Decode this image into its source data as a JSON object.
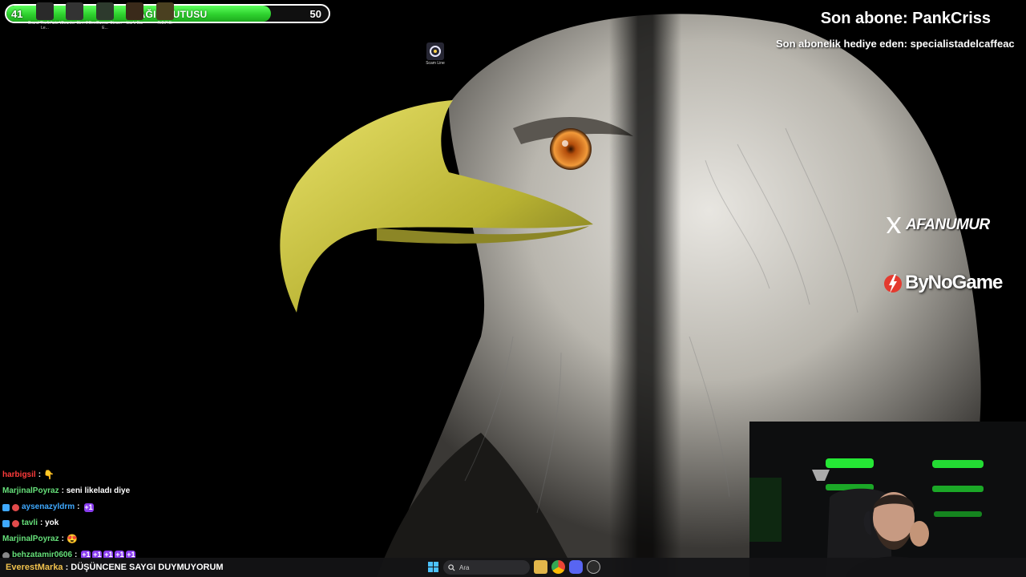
{
  "donation": {
    "title": "BAĞIŞ KUTUSU",
    "current": "41",
    "goal": "50",
    "progress_fraction": 0.82,
    "fill_color": "#33d633"
  },
  "desktop_icons": [
    {
      "label": "Grand Theft Auto V Le...",
      "icon": "gta-icon"
    },
    {
      "label": "Counter-Str... 2",
      "icon": "cs2-icon"
    },
    {
      "label": "GeoGuessr Steam E...",
      "icon": "geoguessr-icon"
    },
    {
      "label": "Liar's Bar",
      "icon": "liars-bar-icon"
    },
    {
      "label": "R.E.P.O.",
      "icon": "repo-icon"
    },
    {
      "label": "Scam Line",
      "icon": "scam-line-icon"
    }
  ],
  "overlay": {
    "last_sub": "Son abone: PankCriss",
    "last_gift": "Son abonelik hediye eden: specialistadelcaffeac",
    "twitter_handle": "AFANUMUR",
    "sponsor": "ByNoGame",
    "accent_red": "#e43a2f"
  },
  "chat": [
    {
      "user": "harbigsil",
      "user_color": "#ff3b3b",
      "text": ":",
      "emote": "👇"
    },
    {
      "user": "MarjinalPoyraz",
      "user_color": "#66e07a",
      "text": ": seni likeladı diye"
    },
    {
      "user": "aysenazyldrm",
      "user_color": "#3fa9ff",
      "text": ":",
      "emote": "+1"
    },
    {
      "user": "tavli",
      "user_color": "#66e07a",
      "text": ": yok"
    },
    {
      "user": "MarjinalPoyraz",
      "user_color": "#66e07a",
      "text": ":",
      "emote": "😍"
    },
    {
      "user": "behzatamir0606",
      "user_color": "#66e07a",
      "text": ":",
      "emote_count": 5
    }
  ],
  "ticker": {
    "user": "EverestMarka",
    "message": ": DÜŞÜNCENE SAYGI DUYMUYORUM"
  },
  "taskbar": {
    "search_placeholder": "Ara",
    "icons": [
      "windows-start-icon",
      "search-icon",
      "file-explorer-icon",
      "chrome-icon",
      "discord-icon",
      "obs-icon",
      "steam-icon"
    ]
  }
}
